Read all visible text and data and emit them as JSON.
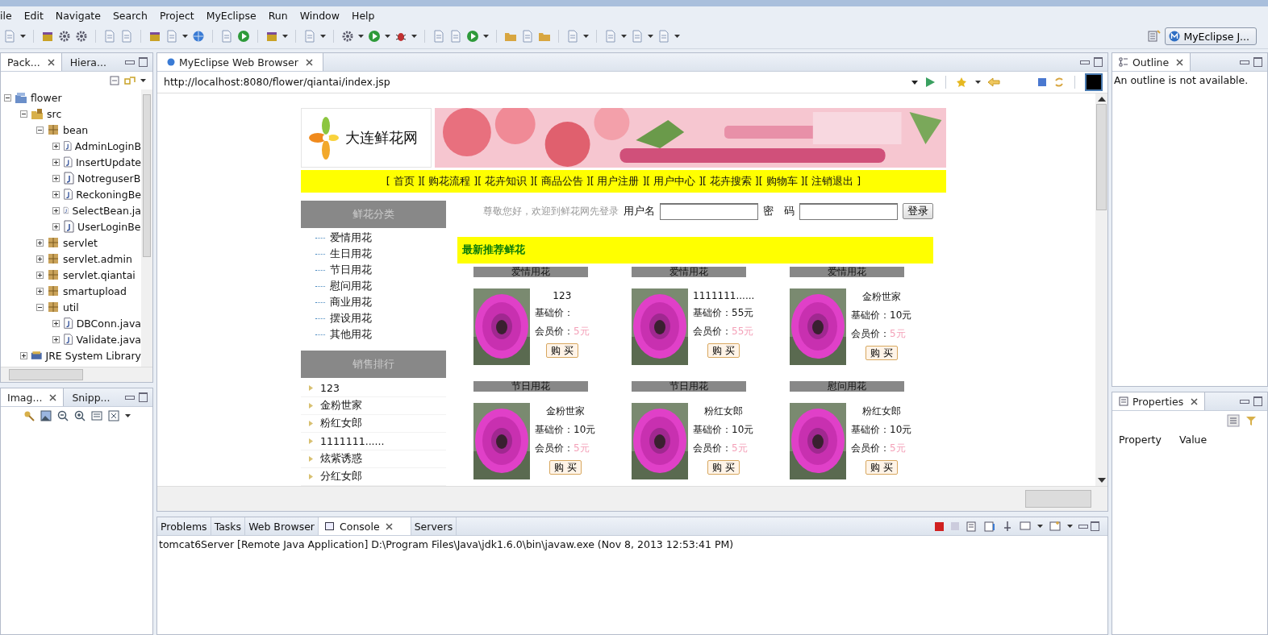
{
  "menu": [
    "ile",
    "Edit",
    "Navigate",
    "Search",
    "Project",
    "MyEclipse",
    "Run",
    "Window",
    "Help"
  ],
  "perspective": "MyEclipse J...",
  "left_top": {
    "tabs": [
      {
        "label": "Pack...",
        "selected": true
      },
      {
        "label": "Hiera...",
        "selected": false
      }
    ],
    "tree": [
      {
        "label": "flower",
        "kind": "project",
        "expanded": true,
        "children": [
          {
            "label": "src",
            "kind": "source",
            "expanded": true,
            "children": [
              {
                "label": "bean",
                "kind": "package",
                "expanded": true,
                "children": [
                  {
                    "label": "AdminLoginB",
                    "kind": "java",
                    "expanded": false
                  },
                  {
                    "label": "InsertUpdate",
                    "kind": "java",
                    "expanded": false
                  },
                  {
                    "label": "NotreguserB",
                    "kind": "java",
                    "expanded": false
                  },
                  {
                    "label": "ReckoningBe",
                    "kind": "java",
                    "expanded": false
                  },
                  {
                    "label": "SelectBean.ja",
                    "kind": "java",
                    "expanded": false
                  },
                  {
                    "label": "UserLoginBe",
                    "kind": "java",
                    "expanded": false
                  }
                ]
              },
              {
                "label": "servlet",
                "kind": "package",
                "expanded": false
              },
              {
                "label": "servlet.admin",
                "kind": "package",
                "expanded": false
              },
              {
                "label": "servlet.qiantai",
                "kind": "package",
                "expanded": false
              },
              {
                "label": "smartupload",
                "kind": "package",
                "expanded": false
              },
              {
                "label": "util",
                "kind": "package",
                "expanded": true,
                "children": [
                  {
                    "label": "DBConn.java",
                    "kind": "java",
                    "expanded": false
                  },
                  {
                    "label": "Validate.java",
                    "kind": "java",
                    "expanded": false
                  }
                ]
              }
            ]
          },
          {
            "label": "JRE System Library",
            "kind": "library",
            "expanded": false
          }
        ]
      }
    ]
  },
  "left_bottom": {
    "tabs": [
      {
        "label": "Imag...",
        "selected": true
      },
      {
        "label": "Snipp...",
        "selected": false
      }
    ]
  },
  "editor": {
    "tabs": [
      {
        "label": "MyEclipse Web Browser",
        "selected": true
      }
    ],
    "url": "http://localhost:8080/flower/qiantai/index.jsp",
    "page": {
      "site_name": "大连鲜花网",
      "nav": [
        "[ 首页 ]",
        "[ 购花流程 ]",
        "[ 花卉知识 ]",
        "[ 商品公告 ]",
        "[ 用户注册 ]",
        "[ 用户中心 ]",
        "[ 花卉搜索 ]",
        "[ 购物车 ]",
        "[ 注销退出 ]"
      ],
      "category_title": "鲜花分类",
      "categories": [
        "爱情用花",
        "生日用花",
        "节日用花",
        "慰问用花",
        "商业用花",
        "摆设用花",
        "其他用花"
      ],
      "ranking_title": "销售排行",
      "ranking": [
        "123",
        "金粉世家",
        "粉红女郎",
        "1111111......",
        "炫紫诱惑",
        "分红女郎"
      ],
      "login": {
        "prompt": "尊敬您好，欢迎到鲜花网先登录",
        "user_label": "用户名",
        "password_label": "密　码",
        "button": "登录"
      },
      "featured_title": "最新推荐鲜花",
      "products": [
        {
          "category": "爱情用花",
          "name": "123",
          "base_label": "基础价：",
          "member_label": "会员价：",
          "member": "5元",
          "button": "购 买"
        },
        {
          "category": "爱情用花",
          "name": "1111111......",
          "base_label": "基础价：",
          "base": "55元",
          "member_label": "会员价：",
          "member": "55元",
          "button": "购 买"
        },
        {
          "category": "爱情用花",
          "name": "金粉世家",
          "base_label": "基础价：",
          "base": "10元",
          "member_label": "会员价：",
          "member": "5元",
          "button": "购 买"
        },
        {
          "category": "节日用花",
          "name": "金粉世家",
          "base_label": "基础价：",
          "base": "10元",
          "member_label": "会员价：",
          "member": "5元",
          "button": "购 买"
        },
        {
          "category": "节日用花",
          "name": "粉红女郎",
          "base_label": "基础价：",
          "base": "10元",
          "member_label": "会员价：",
          "member": "5元",
          "button": "购 买"
        },
        {
          "category": "慰问用花",
          "name": "粉红女郎",
          "base_label": "基础价：",
          "base": "10元",
          "member_label": "会员价：",
          "member": "5元",
          "button": "购 买"
        }
      ]
    }
  },
  "outline": {
    "tabs": [
      {
        "label": "Outline",
        "selected": true
      }
    ],
    "message": "An outline is not available."
  },
  "properties": {
    "tabs": [
      {
        "label": "Properties",
        "selected": true
      }
    ],
    "columns": [
      "Property",
      "Value"
    ]
  },
  "console": {
    "tabs": [
      {
        "label": "Problems",
        "selected": false
      },
      {
        "label": "Tasks",
        "selected": false
      },
      {
        "label": "Web Browser",
        "selected": false
      },
      {
        "label": "Console",
        "selected": true
      },
      {
        "label": "Servers",
        "selected": false
      }
    ],
    "line": "tomcat6Server [Remote Java Application] D:\\Program Files\\Java\\jdk1.6.0\\bin\\javaw.exe (Nov 8, 2013 12:53:41 PM)"
  }
}
